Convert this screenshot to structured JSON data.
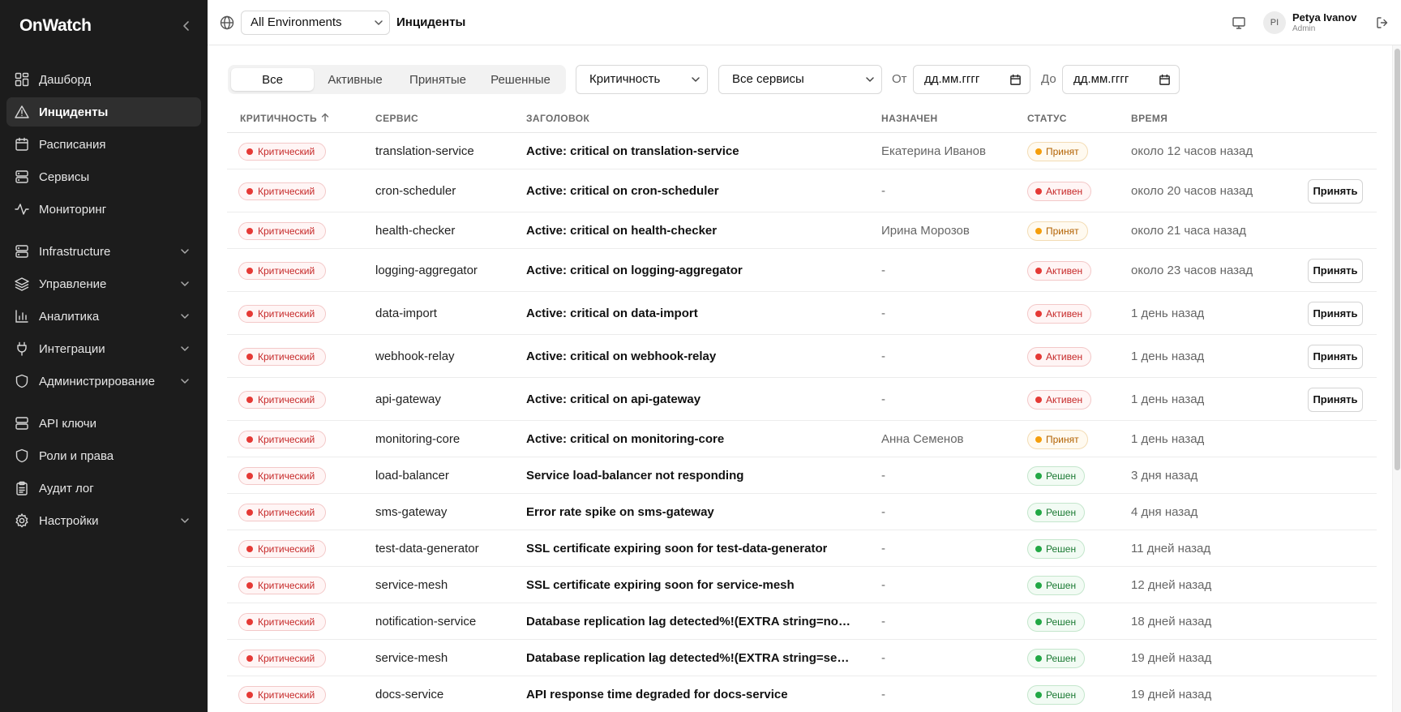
{
  "app": {
    "brand": "OnWatch"
  },
  "sidebar": {
    "items": [
      {
        "label": "Дашборд",
        "icon": "dashboard-icon"
      },
      {
        "label": "Инциденты",
        "icon": "alert-triangle-icon",
        "active": true
      },
      {
        "label": "Расписания",
        "icon": "calendar-icon"
      },
      {
        "label": "Сервисы",
        "icon": "server-icon"
      },
      {
        "label": "Мониторинг",
        "icon": "activity-icon"
      },
      {
        "label": "Infrastructure",
        "icon": "server-icon",
        "expandable": true
      },
      {
        "label": "Управление",
        "icon": "layers-icon",
        "expandable": true
      },
      {
        "label": "Аналитика",
        "icon": "bar-chart-icon",
        "expandable": true
      },
      {
        "label": "Интеграции",
        "icon": "plug-icon",
        "expandable": true
      },
      {
        "label": "Администрирование",
        "icon": "shield-icon",
        "expandable": true
      },
      {
        "label": "API ключи",
        "icon": "database-icon"
      },
      {
        "label": "Роли и права",
        "icon": "shield-icon"
      },
      {
        "label": "Аудит лог",
        "icon": "clipboard-icon"
      },
      {
        "label": "Настройки",
        "icon": "gear-icon",
        "expandable": true
      }
    ]
  },
  "header": {
    "environment": "All Environments",
    "title": "Инциденты",
    "user": {
      "initials": "PI",
      "name": "Petya Ivanov",
      "role": "Admin"
    }
  },
  "filters": {
    "tabs": [
      "Все",
      "Активные",
      "Принятые",
      "Решенные"
    ],
    "active_tab": "Все",
    "severity": "Критичность",
    "services": "Все сервисы",
    "from_label": "От",
    "to_label": "До",
    "date_placeholder": "дд.мм.гггг"
  },
  "table": {
    "columns": {
      "severity": "КРИТИЧНОСТЬ",
      "service": "СЕРВИС",
      "title": "ЗАГОЛОВОК",
      "assignee": "НАЗНАЧЕН",
      "status": "СТАТУС",
      "time": "ВРЕМЯ"
    },
    "accept_label": "Принять",
    "rows": [
      {
        "severity": "Критический",
        "service": "translation-service",
        "title": "Active: critical on translation-service",
        "assignee": "Екатерина Иванов",
        "status": "Принят",
        "status_kind": "ack",
        "time": "около 12 часов назад",
        "can_accept": false
      },
      {
        "severity": "Критический",
        "service": "cron-scheduler",
        "title": "Active: critical on cron-scheduler",
        "assignee": "-",
        "status": "Активен",
        "status_kind": "active",
        "time": "около 20 часов назад",
        "can_accept": true
      },
      {
        "severity": "Критический",
        "service": "health-checker",
        "title": "Active: critical on health-checker",
        "assignee": "Ирина Морозов",
        "status": "Принят",
        "status_kind": "ack",
        "time": "около 21 часа назад",
        "can_accept": false
      },
      {
        "severity": "Критический",
        "service": "logging-aggregator",
        "title": "Active: critical on logging-aggregator",
        "assignee": "-",
        "status": "Активен",
        "status_kind": "active",
        "time": "около 23 часов назад",
        "can_accept": true
      },
      {
        "severity": "Критический",
        "service": "data-import",
        "title": "Active: critical on data-import",
        "assignee": "-",
        "status": "Активен",
        "status_kind": "active",
        "time": "1 день назад",
        "can_accept": true
      },
      {
        "severity": "Критический",
        "service": "webhook-relay",
        "title": "Active: critical on webhook-relay",
        "assignee": "-",
        "status": "Активен",
        "status_kind": "active",
        "time": "1 день назад",
        "can_accept": true
      },
      {
        "severity": "Критический",
        "service": "api-gateway",
        "title": "Active: critical on api-gateway",
        "assignee": "-",
        "status": "Активен",
        "status_kind": "active",
        "time": "1 день назад",
        "can_accept": true
      },
      {
        "severity": "Критический",
        "service": "monitoring-core",
        "title": "Active: critical on monitoring-core",
        "assignee": "Анна Семенов",
        "status": "Принят",
        "status_kind": "ack",
        "time": "1 день назад",
        "can_accept": false
      },
      {
        "severity": "Критический",
        "service": "load-balancer",
        "title": "Service load-balancer not responding",
        "assignee": "-",
        "status": "Решен",
        "status_kind": "resolved",
        "time": "3 дня назад",
        "can_accept": false
      },
      {
        "severity": "Критический",
        "service": "sms-gateway",
        "title": "Error rate spike on sms-gateway",
        "assignee": "-",
        "status": "Решен",
        "status_kind": "resolved",
        "time": "4 дня назад",
        "can_accept": false
      },
      {
        "severity": "Критический",
        "service": "test-data-generator",
        "title": "SSL certificate expiring soon for test-data-generator",
        "assignee": "-",
        "status": "Решен",
        "status_kind": "resolved",
        "time": "11 дней назад",
        "can_accept": false
      },
      {
        "severity": "Критический",
        "service": "service-mesh",
        "title": "SSL certificate expiring soon for service-mesh",
        "assignee": "-",
        "status": "Решен",
        "status_kind": "resolved",
        "time": "12 дней назад",
        "can_accept": false
      },
      {
        "severity": "Критический",
        "service": "notification-service",
        "title": "Database replication lag detected%!(EXTRA string=notificati…",
        "assignee": "-",
        "status": "Решен",
        "status_kind": "resolved",
        "time": "18 дней назад",
        "can_accept": false
      },
      {
        "severity": "Критический",
        "service": "service-mesh",
        "title": "Database replication lag detected%!(EXTRA string=service-…",
        "assignee": "-",
        "status": "Решен",
        "status_kind": "resolved",
        "time": "19 дней назад",
        "can_accept": false
      },
      {
        "severity": "Критический",
        "service": "docs-service",
        "title": "API response time degraded for docs-service",
        "assignee": "-",
        "status": "Решен",
        "status_kind": "resolved",
        "time": "19 дней назад",
        "can_accept": false
      }
    ]
  },
  "colors": {
    "sidebar_bg": "#1c1c1c",
    "critical": "#e53935",
    "acknowledged": "#f59e0b",
    "resolved": "#22a845"
  }
}
